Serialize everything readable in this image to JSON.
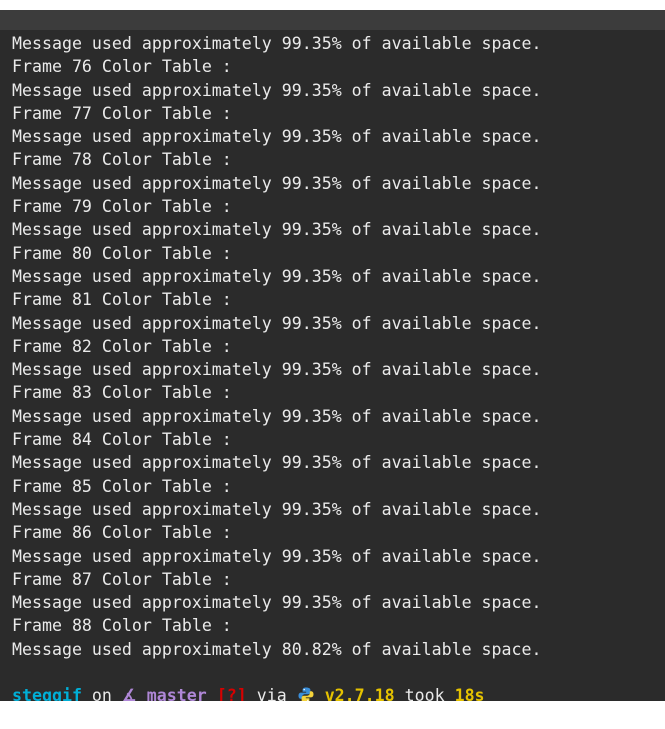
{
  "terminal": {
    "lines": [
      "Message used approximately 99.35% of available space.",
      "Frame 76 Color Table :",
      "Message used approximately 99.35% of available space.",
      "Frame 77 Color Table :",
      "Message used approximately 99.35% of available space.",
      "Frame 78 Color Table :",
      "Message used approximately 99.35% of available space.",
      "Frame 79 Color Table :",
      "Message used approximately 99.35% of available space.",
      "Frame 80 Color Table :",
      "Message used approximately 99.35% of available space.",
      "Frame 81 Color Table :",
      "Message used approximately 99.35% of available space.",
      "Frame 82 Color Table :",
      "Message used approximately 99.35% of available space.",
      "Frame 83 Color Table :",
      "Message used approximately 99.35% of available space.",
      "Frame 84 Color Table :",
      "Message used approximately 99.35% of available space.",
      "Frame 85 Color Table :",
      "Message used approximately 99.35% of available space.",
      "Frame 86 Color Table :",
      "Message used approximately 99.35% of available space.",
      "Frame 87 Color Table :",
      "Message used approximately 99.35% of available space.",
      "Frame 88 Color Table :",
      "Message used approximately 80.82% of available space."
    ],
    "prompt": {
      "directory": "steggif",
      "on_word": " on ",
      "branch_icon_glyph": "∡",
      "branch": "master",
      "status": "[?]",
      "via_word": " via ",
      "python_version": "v2.7.18",
      "took_word": " took ",
      "duration": "18s",
      "input_prompt_glyph": "❯"
    },
    "icons": {
      "branch": "git-branch-icon",
      "python": "python-icon",
      "prompt": "chevron-right-icon"
    },
    "colors": {
      "background": "#2b2b2b",
      "text": "#eaeaea",
      "directory": "#00afd7",
      "branch": "#af87d7",
      "status": "#d70000",
      "version": "#e5c200",
      "prompt_chevron": "#e5a000"
    }
  }
}
